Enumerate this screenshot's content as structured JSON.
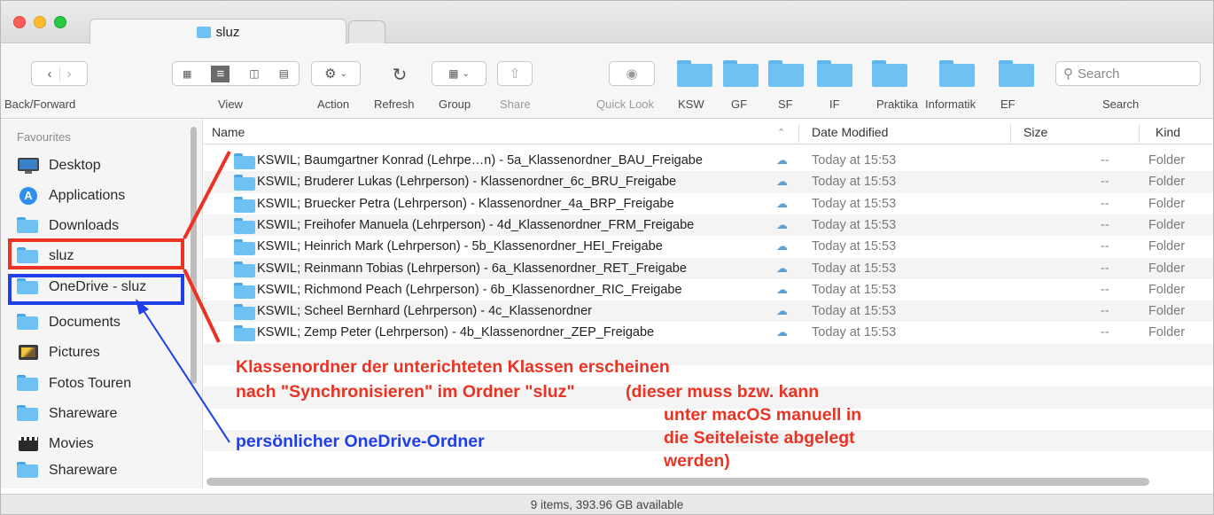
{
  "window": {
    "tab_title": "sluz",
    "status": "9 items, 393.96 GB available"
  },
  "toolbar": {
    "labels": {
      "back_forward": "Back/Forward",
      "view": "View",
      "action": "Action",
      "refresh": "Refresh",
      "group": "Group",
      "share": "Share",
      "quick_look": "Quick Look",
      "search": "Search"
    },
    "favorites": [
      "KSW",
      "GF",
      "SF",
      "IF",
      "Praktika",
      "Informatik",
      "EF"
    ],
    "search_placeholder": "Search"
  },
  "sidebar": {
    "header": "Favourites",
    "items": [
      {
        "label": "Desktop",
        "icon": "desktop-icon"
      },
      {
        "label": "Applications",
        "icon": "applications-icon"
      },
      {
        "label": "Downloads",
        "icon": "downloads-folder-icon"
      },
      {
        "label": "sluz",
        "icon": "folder-icon"
      },
      {
        "label": "OneDrive - sluz",
        "icon": "onedrive-folder-icon"
      },
      {
        "label": "Documents",
        "icon": "documents-folder-icon"
      },
      {
        "label": "Pictures",
        "icon": "pictures-icon"
      },
      {
        "label": "Fotos Touren",
        "icon": "folder-icon"
      },
      {
        "label": "Shareware",
        "icon": "folder-icon"
      },
      {
        "label": "Movies",
        "icon": "movies-icon"
      },
      {
        "label": "Shareware",
        "icon": "folder-icon"
      }
    ]
  },
  "list": {
    "columns": {
      "name": "Name",
      "date": "Date Modified",
      "size": "Size",
      "kind": "Kind"
    },
    "rows": [
      {
        "name": "KSWIL; Baumgartner Konrad (Lehrpe…n) - 5a_Klassenordner_BAU_Freigabe",
        "date": "Today at 15:53",
        "size": "--",
        "kind": "Folder"
      },
      {
        "name": "KSWIL; Bruderer Lukas (Lehrperson) - Klassenordner_6c_BRU_Freigabe",
        "date": "Today at 15:53",
        "size": "--",
        "kind": "Folder"
      },
      {
        "name": "KSWIL; Bruecker Petra (Lehrperson) - Klassenordner_4a_BRP_Freigabe",
        "date": "Today at 15:53",
        "size": "--",
        "kind": "Folder"
      },
      {
        "name": "KSWIL; Freihofer Manuela (Lehrperson) - 4d_Klassenordner_FRM_Freigabe",
        "date": "Today at 15:53",
        "size": "--",
        "kind": "Folder"
      },
      {
        "name": "KSWIL; Heinrich Mark (Lehrperson) - 5b_Klassenordner_HEI_Freigabe",
        "date": "Today at 15:53",
        "size": "--",
        "kind": "Folder"
      },
      {
        "name": "KSWIL; Reinmann Tobias (Lehrperson) - 6a_Klassenordner_RET_Freigabe",
        "date": "Today at 15:53",
        "size": "--",
        "kind": "Folder"
      },
      {
        "name": "KSWIL; Richmond Peach (Lehrperson) - 6b_Klassenordner_RIC_Freigabe",
        "date": "Today at 15:53",
        "size": "--",
        "kind": "Folder"
      },
      {
        "name": "KSWIL; Scheel Bernhard (Lehrperson) - 4c_Klassenordner",
        "date": "Today at 15:53",
        "size": "--",
        "kind": "Folder"
      },
      {
        "name": "KSWIL; Zemp Peter (Lehrperson) - 4b_Klassenordner_ZEP_Freigabe",
        "date": "Today at 15:53",
        "size": "--",
        "kind": "Folder"
      }
    ]
  },
  "annotations": {
    "red_line1": "Klassenordner der unterichteten Klassen erscheinen",
    "red_line2": "nach \"Synchronisieren\" im Ordner \"sluz\"",
    "red_line3": "(dieser muss bzw. kann",
    "red_line4": "unter macOS manuell in",
    "red_line5": "die Seiteleiste abgelegt",
    "red_line6": "werden)",
    "blue_text": "persönlicher OneDrive-Ordner"
  },
  "colors": {
    "annotation_red": "#ea3323",
    "annotation_blue": "#1f3fe8",
    "folder_blue": "#6ec1f3"
  }
}
